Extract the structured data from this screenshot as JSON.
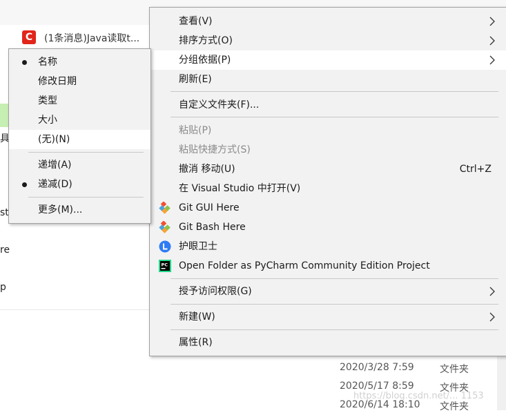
{
  "background": {
    "tab_icon_letter": "C",
    "tab_title": "(1条消息)Java读取t...",
    "fragments": [
      "具",
      "st",
      "re",
      "p"
    ],
    "rows": [
      {
        "date": "2020/3/28 7:59",
        "type": "文件夹"
      },
      {
        "date": "2020/5/17 8:59",
        "type": "文件夹"
      },
      {
        "date": "2020/6/14 18:10",
        "type": "文件夹"
      }
    ],
    "watermark": "https://blog.csdn.net/... 1153"
  },
  "main_menu": {
    "view": "查看(V)",
    "sort_by": "排序方式(O)",
    "group_by": "分组依据(P)",
    "refresh": "刷新(E)",
    "customize_folder": "自定义文件夹(F)...",
    "paste": "粘贴(P)",
    "paste_shortcut": "粘贴快捷方式(S)",
    "undo_move": "撤消 移动(U)",
    "undo_shortcut": "Ctrl+Z",
    "open_in_vs": "在 Visual Studio 中打开(V)",
    "git_gui": "Git GUI Here",
    "git_bash": "Git Bash Here",
    "eye_guard": "护眼卫士",
    "open_pycharm": "Open Folder as PyCharm Community Edition Project",
    "grant_access": "授予访问权限(G)",
    "new": "新建(W)",
    "properties": "属性(R)"
  },
  "group_submenu": {
    "name": "名称",
    "date_modified": "修改日期",
    "type": "类型",
    "size": "大小",
    "none": "(无)(N)",
    "ascending": "递增(A)",
    "descending": "递减(D)",
    "more": "更多(M)...",
    "selected_field": "名称",
    "selected_order": "递减(D)"
  },
  "colors": {
    "menu_bg": "#f2f2f2",
    "highlight": "#ffffff",
    "brand_csdn": "#e1251b",
    "git_orange": "#f05133",
    "eye_blue": "#2f7bf5"
  }
}
